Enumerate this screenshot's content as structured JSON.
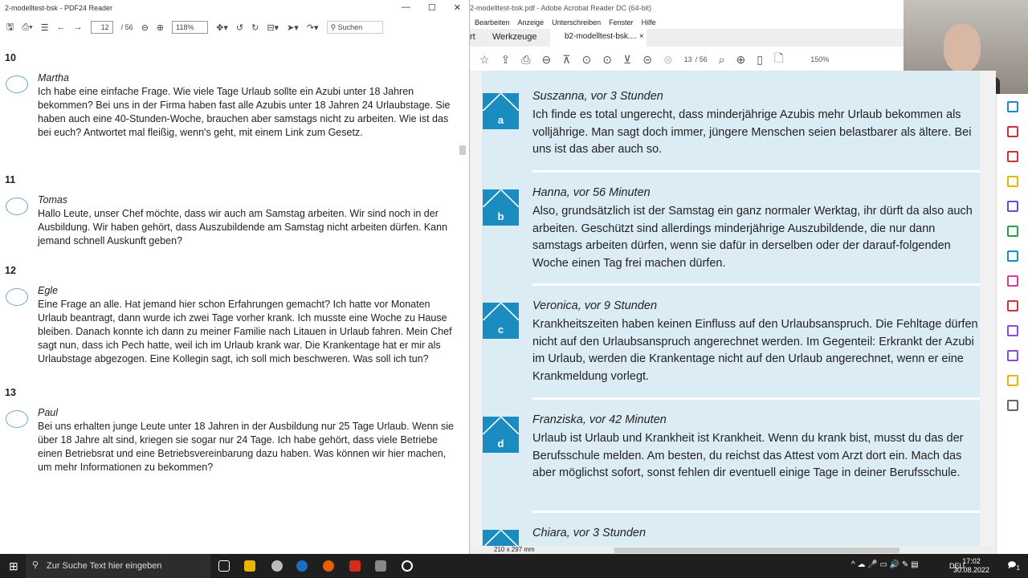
{
  "left_window": {
    "title": "2-modelltest-bsk - PDF24 Reader",
    "page_current": "12",
    "page_total": "/ 56",
    "zoom": "118%",
    "search_placeholder": "Suchen",
    "questions": [
      {
        "number": "10",
        "name": "Martha",
        "text": "Ich habe eine einfache Frage. Wie viele Tage Urlaub sollte ein Azubi unter 18 Jahren bekommen? Bei uns in der Firma haben fast alle Azubis unter 18 Jahren 24 Urlaubstage. Sie haben auch eine 40-Stunden-Woche, brauchen aber samstags nicht zu arbeiten. Wie ist das bei euch? Antwortet mal fleißig, wenn's geht, mit einem Link zum Gesetz."
      },
      {
        "number": "11",
        "name": "Tomas",
        "text": "Hallo Leute, unser Chef möchte, dass wir auch am Samstag arbeiten. Wir sind noch in der Ausbildung. Wir haben gehört, dass Auszubildende am Samstag nicht arbeiten dürfen. Kann jemand schnell Auskunft geben?"
      },
      {
        "number": "12",
        "name": "Egle",
        "text": "Eine Frage an alle. Hat jemand hier schon Erfahrungen gemacht? Ich hatte vor Monaten Urlaub beantragt, dann wurde ich zwei Tage vorher krank. Ich musste eine Woche zu Hause bleiben. Danach konnte ich dann zu meiner Familie nach Litauen in Urlaub fahren. Mein Chef sagt nun, dass ich Pech hatte, weil ich im Urlaub krank war. Die Krankentage hat er mir als Urlaubstage abgezogen. Eine Kollegin sagt, ich soll mich beschweren. Was soll ich tun?"
      },
      {
        "number": "13",
        "name": "Paul",
        "text": "Bei uns erhalten junge Leute unter 18 Jahren in der Ausbildung nur 25 Tage Urlaub. Wenn sie über 18 Jahre alt sind, kriegen sie sogar nur 24 Tage. Ich habe gehört, dass viele Betriebe einen Betriebsrat und eine Betriebsvereinbarung dazu haben. Was können wir hier machen, um mehr Informationen zu bekommen?"
      }
    ]
  },
  "right_window": {
    "title": "2-modelltest-bsk.pdf - Adobe Acrobat Reader DC (64-bit)",
    "menu": [
      "Bearbeiten",
      "Anzeige",
      "Unterschreiben",
      "Fenster",
      "Hilfe"
    ],
    "tabs": {
      "start_partial": "rt",
      "tools": "Werkzeuge",
      "document": "b2-modelltest-bsk...."
    },
    "page_current": "13",
    "page_total": "/ 56",
    "zoom": "150%",
    "page_size": "210 x 297 mm",
    "entries": [
      {
        "letter": "a",
        "name": "Suszanna, vor 3 Stunden",
        "text": "Ich finde es total ungerecht, dass minderjährige Azubis mehr Urlaub bekommen als volljährige. Man sagt doch immer, jüngere Menschen seien belastbarer als ältere. Bei uns ist das aber auch so."
      },
      {
        "letter": "b",
        "name": "Hanna, vor 56 Minuten",
        "text": "Also, grundsätzlich ist der Samstag ein ganz normaler Werktag, ihr dürft da also auch arbeiten. Geschützt sind allerdings minderjährige Auszubildende, die nur dann samstags arbeiten dürfen, wenn sie dafür in derselben oder der darauf-folgenden Woche einen Tag frei machen dürfen."
      },
      {
        "letter": "c",
        "name": "Veronica, vor 9 Stunden",
        "text": "Krankheitszeiten haben keinen Einfluss auf den Urlaubsanspruch. Die Fehltage dürfen nicht auf den Urlaubsanspruch angerechnet werden. Im Gegenteil: Erkrankt der Azubi im Urlaub, werden die Krankentage nicht auf den Urlaub angerechnet, wenn er eine Krankmeldung vorlegt."
      },
      {
        "letter": "d",
        "name": "Franziska, vor 42 Minuten",
        "text": "Urlaub ist Urlaub und Krankheit ist Krankheit. Wenn du krank bist, musst du das der Berufsschule melden. Am besten, du reichst das Attest vom Arzt dort ein. Mach das aber möglichst sofort, sonst fehlen dir eventuell einige Tage in deiner Berufsschule."
      },
      {
        "letter": "",
        "name": "Chiara, vor 3 Stunden",
        "text": ""
      }
    ]
  },
  "taskbar": {
    "search_placeholder": "Zur Suche Text hier eingeben",
    "language": "DEU",
    "time": "17:02",
    "date": "30.08.2022",
    "notifications": "1"
  }
}
